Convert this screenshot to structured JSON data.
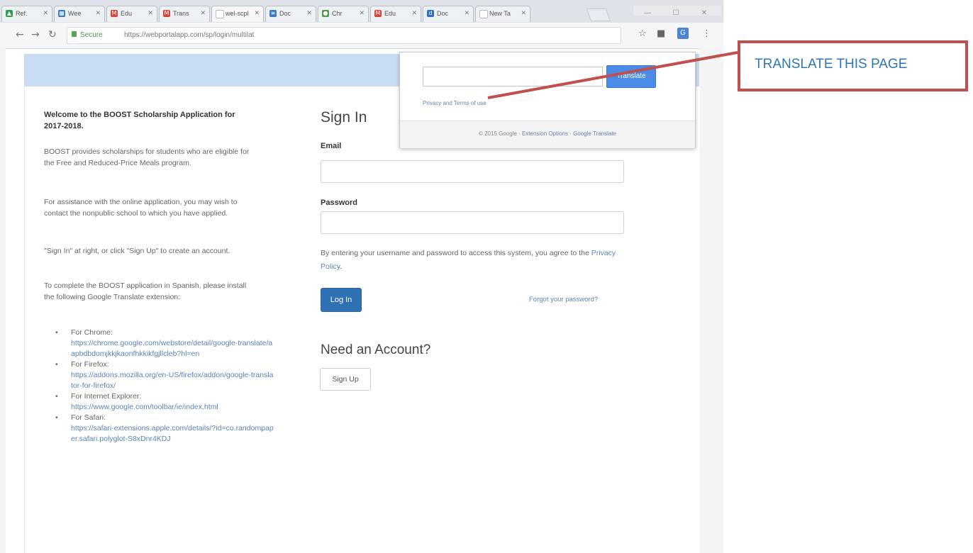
{
  "browser": {
    "tabs": [
      {
        "label": "Ref.",
        "icon_color": "#2e9e4b",
        "icon": "drive-icon"
      },
      {
        "label": "Wee",
        "icon_color": "#3b78c2",
        "icon": "calendar-icon"
      },
      {
        "label": "Edu",
        "icon_color": "#d44638",
        "icon": "gmail-icon"
      },
      {
        "label": "Trans",
        "icon_color": "#d44638",
        "icon": "gmail-icon"
      },
      {
        "label": "wel-scpl",
        "icon_color": "#ffffff",
        "icon": "page-icon"
      },
      {
        "label": "Doc",
        "icon_color": "#3b78c2",
        "icon": "docs-icon"
      },
      {
        "label": "Chr",
        "icon_color": "#4a9e4a",
        "icon": "chrome-icon"
      },
      {
        "label": "Edu",
        "icon_color": "#d44638",
        "icon": "gmail-icon"
      },
      {
        "label": "Doc",
        "icon_color": "#2f6fc4",
        "icon": "d-icon"
      },
      {
        "label": "New Ta",
        "icon_color": "#ffffff",
        "icon": "page-icon"
      }
    ],
    "address": {
      "secure_label": "Secure",
      "url": "https://webportalapp.com/sp/login/multilat"
    }
  },
  "sidebar_text": {
    "title": "Welcome to the BOOST Scholarship Application for 2017-2018.",
    "p1": "BOOST provides scholarships for students who are eligible for the Free and Reduced-Price Meals program.",
    "p2": "For assistance with the online application, you may wish to contact the nonpublic school to which you have applied.",
    "p3": "\"Sign In\" at right, or click \"Sign Up\" to create an account.",
    "p4": "To complete the BOOST application in Spanish, please install the following Google Translate extension:",
    "items": [
      {
        "label": "For Chrome:",
        "link": "https://chrome.google.com/webstore/detail/google-translate/aapbdbdomjkkjkaonfhkkikfgjllcleb?hl=en"
      },
      {
        "label": "For Firefox:",
        "link": "https://addons.mozilla.org/en-US/firefox/addon/google-translator-for-firefox/"
      },
      {
        "label": "For Internet Explorer:",
        "link": "https://www.google.com/toolbar/ie/index.html"
      },
      {
        "label": "For Safari:",
        "link": "https://safari-extensions.apple.com/details/?id=co.randompaper.safari.polyglot-S8xDnr4KDJ"
      }
    ]
  },
  "signin": {
    "title": "Sign In",
    "email_label": "Email",
    "password_label": "Password",
    "terms_text": "By entering your username and password to access this system, you agree to the ",
    "privacy_link": "Privacy Policy",
    "terms_end": ".",
    "login_label": "Log In",
    "forgot_label": "Forgot your password?",
    "need_account": "Need an Account?",
    "signup_label": "Sign Up"
  },
  "translate_popup": {
    "button_label": "Translate",
    "privacy_text": "Privacy and Terms of use",
    "footer_prefix": "© 2015 Google · ",
    "footer_options": "Extension Options",
    "footer_sep": " · ",
    "footer_link": "Google Translate"
  },
  "annotation": {
    "label": "TRANSLATE THIS PAGE",
    "color": "#c0504d",
    "text_color": "#2e75b6"
  }
}
